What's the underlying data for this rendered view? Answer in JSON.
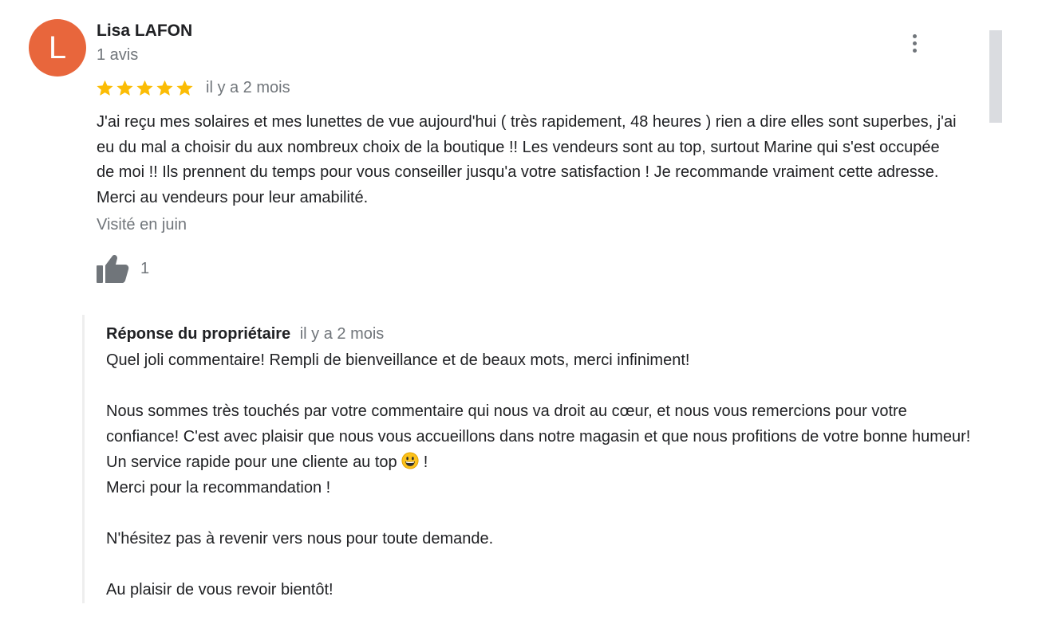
{
  "review": {
    "avatar_letter": "L",
    "avatar_color": "#e8663c",
    "author_name": "Lisa LAFON",
    "author_meta": "1 avis",
    "rating": 5,
    "rating_max": 5,
    "star_color": "#fbbc04",
    "date": "il y a 2 mois",
    "text": "J'ai reçu mes solaires et mes lunettes de vue aujourd'hui ( très rapidement, 48 heures ) rien a dire elles sont superbes, j'ai eu du mal a choisir du aux nombreux choix de la boutique !! Les vendeurs sont au top, surtout Marine qui s'est occupée de moi  !! Ils prennent du temps pour vous conseiller jusqu'a votre satisfaction ! Je recommande vraiment cette adresse. Merci au vendeurs pour leur amabilité.",
    "visited": "Visité en juin",
    "like_count": "1",
    "icons": {
      "more": "more-vert-icon",
      "like": "thumb-up-icon",
      "star": "star-icon"
    }
  },
  "owner_reply": {
    "title": "Réponse du propriétaire",
    "date": "il y a 2 mois",
    "line1": "Quel joli commentaire! Rempli de bienveillance et de beaux mots, merci infiniment!",
    "line2": "Nous sommes très touchés par votre commentaire qui nous va droit au cœur, et nous vous remercions pour votre confiance! C'est avec plaisir que nous vous accueillons dans notre magasin et que nous profitions de votre bonne humeur! Un service rapide pour une cliente au top",
    "line2_end": " !",
    "line3": "Merci pour la recommandation !",
    "line4": "N'hésitez pas à revenir vers nous pour toute demande.",
    "line5": "Au plaisir de vous revoir bientôt!",
    "emoji": "smiley-emoji"
  }
}
